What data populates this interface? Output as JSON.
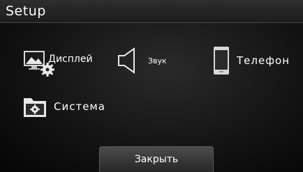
{
  "header": {
    "title": "Setup"
  },
  "menu": {
    "display": {
      "label": "Дисплей",
      "icon": "display-settings-icon"
    },
    "sound": {
      "label": "Звук",
      "icon": "speaker-icon"
    },
    "phone": {
      "label": "Телефон",
      "icon": "phone-icon"
    },
    "system": {
      "label": "Система",
      "icon": "system-folder-icon"
    }
  },
  "footer": {
    "close_label": "Закрыть"
  }
}
